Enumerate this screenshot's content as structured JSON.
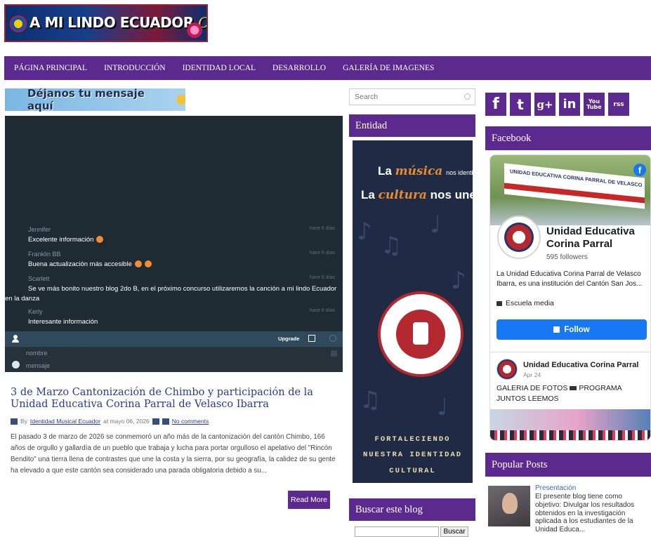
{
  "header": {
    "logo_text": "A MI LINDO ECUADOR",
    "logo_script": "CORINA"
  },
  "nav": {
    "items": [
      "PÁGINA PRINCIPAL",
      "INTRODUCCIÓN",
      "IDENTIDAD LOCAL",
      "DESARROLLO",
      "GALERÍA DE IMAGENES"
    ]
  },
  "message_banner": "Déjanos tu mensaje aquí",
  "chat": {
    "messages": [
      {
        "name": "Jennifer",
        "time": "hace 6 días",
        "text": "Excelente información"
      },
      {
        "name": "Franklin BB",
        "time": "hace 6 días",
        "text": "Buena actualización más accesible"
      },
      {
        "name": "Scarlett",
        "time": "hace 6 días",
        "text": "Se ve más bonito nuestro blog 2do B, en el próximo concurso utilizaremos la canción a mi lindo Ecuador en la danza"
      },
      {
        "name": "Kerly",
        "time": "hace 6 días",
        "text": "Interesante información"
      }
    ],
    "upgrade_label": "Upgrade",
    "name_placeholder": "nombre",
    "message_placeholder": "mensaje"
  },
  "post": {
    "title": "3 de Marzo Cantonización de Chimbo y participación de la Unidad Educativa Corina Parral de Velasco Ibarra",
    "by": "By",
    "author": "Identidad Musical Ecuador",
    "date": "at mayo 06, 2026",
    "comments": "No comments",
    "body": "El pasado 3 de marzo de 2026 se conmemoró un año más de la cantonización del cantón Chimbo, 166 años de orgullo y gallardía de un pueblo que trabaja y lucha para portar orgulloso el apelativo del \"Rincón Bendito\" una tierra llena de contrastes que une la costa y la sierra, por su geografía, la calidez de su gente ha elevado a que este cantón sea considerado una parada obligatoria debido a su...",
    "read_more": "Read More"
  },
  "search": {
    "placeholder": "Search"
  },
  "entidad": {
    "title": "Entidad",
    "line1_a": "La",
    "line1_b": "música",
    "line1_c": "nos identifica,",
    "line2_a": "La",
    "line2_b": "cultura",
    "line2_c": "nos une",
    "bottom1": "FORTALECIENDO",
    "bottom2": "NUESTRA IDENTIDAD",
    "bottom3": "CULTURAL"
  },
  "buscar": {
    "title": "Buscar este blog",
    "button": "Buscar"
  },
  "social": [
    "f",
    "t",
    "g+",
    "in",
    "You Tube",
    "rss"
  ],
  "facebook": {
    "title": "Facebook",
    "cover_sign": "UNIDAD EDUCATIVA CORINA PARRAL DE VELASCO",
    "page_name": "Unidad Educativa Corina Parral",
    "followers": "595 followers",
    "description": "La Unidad Educativa Corina Parral de Velasco Ibarra, es una institución del Cantón San Jos...",
    "category": "Escuela media",
    "follow": "Follow",
    "post_author": "Unidad Educativa Corina Parral",
    "post_date": "Apr 24",
    "post_text_a": "GALERIA DE FOTOS",
    "post_text_b": "PROGRAMA JUNTOS LEEMOS"
  },
  "popular": {
    "title": "Popular Posts",
    "link": "Presentación",
    "text": "El presente blog tiene como objetivo:   Divulgar los resultados obtenidos en la investigación aplicada a los estudiantes de la Unidad Educa..."
  }
}
